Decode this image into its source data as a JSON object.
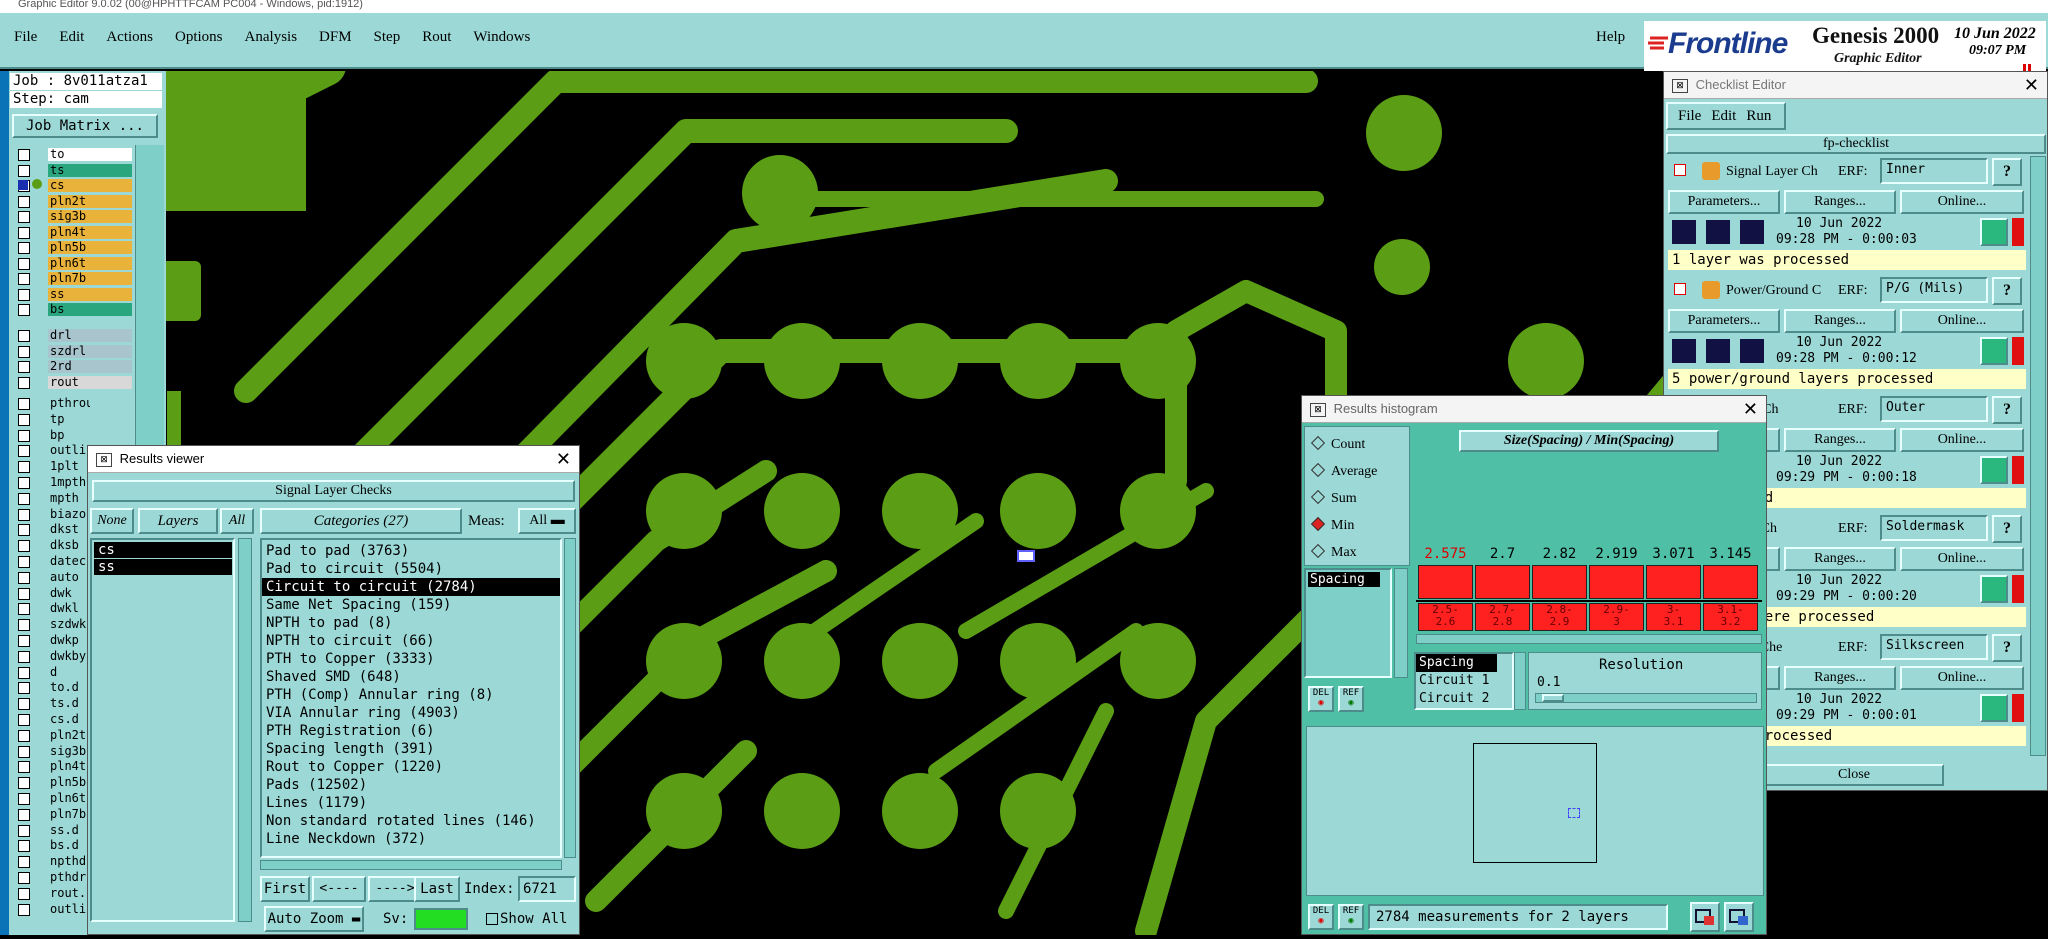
{
  "window_title": "Graphic Editor 9.0.02 (00@HPHTTFCAM PC004 - Windows, pid:1912)",
  "menu": [
    "File",
    "Edit",
    "Actions",
    "Options",
    "Analysis",
    "DFM",
    "Step",
    "Rout",
    "Windows"
  ],
  "help": "Help",
  "brand": {
    "logo": "Frontline",
    "product": "Genesis 2000",
    "subtitle": "Graphic Editor",
    "date": "10 Jun 2022",
    "time": "09:07 PM"
  },
  "job": {
    "job_label": "Job : 8v011atza1",
    "step_label": "Step: cam",
    "matrix_button": "Job Matrix ..."
  },
  "layers_top": [
    {
      "name": "to",
      "color": "#ffffff"
    },
    {
      "name": "ts",
      "color": "#2aa67e"
    },
    {
      "name": "cs",
      "color": "#e9b23a"
    },
    {
      "name": "pln2t",
      "color": "#e9b23a"
    },
    {
      "name": "sig3b",
      "color": "#e9b23a"
    },
    {
      "name": "pln4t",
      "color": "#e9b23a"
    },
    {
      "name": "pln5b",
      "color": "#e9b23a"
    },
    {
      "name": "pln6t",
      "color": "#e9b23a"
    },
    {
      "name": "pln7b",
      "color": "#e9b23a"
    },
    {
      "name": "ss",
      "color": "#e9b23a"
    },
    {
      "name": "bs",
      "color": "#2aa67e"
    }
  ],
  "layers_drill": [
    {
      "name": "drl",
      "color": "#a8c4cc"
    },
    {
      "name": "szdrl",
      "color": "#a8c4cc"
    },
    {
      "name": "2rd",
      "color": "#a8c4cc"
    },
    {
      "name": "rout",
      "color": "#d8d8d8"
    }
  ],
  "layers_misc": [
    "pthrou",
    "tp",
    "bp",
    "outli",
    "1plt",
    "1mpth",
    "mpth",
    "biazo",
    "dkst",
    "dksb",
    "datec",
    "auto",
    "dwk",
    "dwkl",
    "szdwk",
    "dwkp",
    "dwkby",
    "d",
    "to.d",
    "ts.d",
    "cs.d",
    "pln2t",
    "sig3b",
    "pln4t",
    "pln5b",
    "pln6t",
    "pln7b",
    "ss.d",
    "bs.d",
    "npthd",
    "pthdr",
    "rout.",
    "outli"
  ],
  "results_viewer": {
    "title": "Results viewer",
    "header": "Signal Layer Checks",
    "none": "None",
    "layers": "Layers",
    "all": "All",
    "categories_label": "Categories (27)",
    "meas_label": "Meas:",
    "meas_value": "All",
    "layer_items": [
      "cs",
      "ss"
    ],
    "categories": [
      "Pad to pad (3763)",
      "Pad to circuit (5504)",
      "Circuit to circuit (2784)",
      "Same Net Spacing (159)",
      "NPTH to pad (8)",
      "NPTH to circuit (66)",
      "PTH to Copper (3333)",
      "Shaved SMD (648)",
      "PTH (Comp) Annular ring (8)",
      "VIA Annular ring (4903)",
      "PTH Registration (6)",
      "Spacing length (391)",
      "Rout to Copper (1220)",
      "Pads (12502)",
      "Lines (1179)",
      "Non standard rotated lines (146)",
      "Line Neckdown (372)"
    ],
    "selected_category": 2,
    "first": "First",
    "prev": "<----",
    "next": "---->",
    "last": "Last",
    "index_label": "Index:",
    "index_value": "6721",
    "auto_zoom": "Auto Zoom",
    "sv_label": "Sv:",
    "show_all": "Show All"
  },
  "histogram": {
    "title": "Results histogram",
    "options": [
      "Count",
      "Average",
      "Sum",
      "Min",
      "Max"
    ],
    "selected_option": "Min",
    "left_item": "Spacing",
    "chart_title": "Size(Spacing) / Min(Spacing)",
    "bar_values": [
      "2.575",
      "2.7",
      "2.82",
      "2.919",
      "3.071",
      "3.145"
    ],
    "bin_labels": [
      [
        "2.5-",
        "2.6"
      ],
      [
        "2.7-",
        "2.8"
      ],
      [
        "2.8-",
        "2.9"
      ],
      [
        "2.9-",
        "3"
      ],
      [
        "3-",
        "3.1"
      ],
      [
        "3.1-",
        "3.2"
      ]
    ],
    "size_items": [
      "Spacing",
      "Circuit 1",
      "Circuit 2"
    ],
    "resolution_label": "Resolution",
    "resolution_value": "0.1",
    "del": "DEL",
    "ref": "REF",
    "status": "2784 measurements for 2 layers"
  },
  "checklist": {
    "title": "Checklist Editor",
    "menu": [
      "File",
      "Edit",
      "Run"
    ],
    "name": "fp-checklist",
    "erf_label": "ERF:",
    "params": "Parameters...",
    "ranges": "Ranges...",
    "online": "Online...",
    "close": "Close",
    "actions": [
      {
        "name": "Signal Layer Ch",
        "erf": "Inner",
        "date": "10 Jun 2022",
        "time": "09:28 PM - 0:00:03",
        "status": "1 layer was processed"
      },
      {
        "name": "Power/Ground C",
        "erf": "P/G (Mils)",
        "date": "10 Jun 2022",
        "time": "09:28 PM - 0:00:12",
        "status": "5 power/ground layers processed"
      },
      {
        "name": "Layer Ch",
        "erf": "Outer",
        "date": "10 Jun 2022",
        "time": "09:29 PM - 0:00:18",
        "status": "re processed"
      },
      {
        "name": "Mask Ch",
        "erf": "Soldermask",
        "date": "10 Jun 2022",
        "time": "09:29 PM - 0:00:20",
        "status": "sk layers were processed"
      },
      {
        "name": "creen Che",
        "erf": "Silkscreen",
        "date": "10 Jun 2022",
        "time": "09:29 PM - 0:00:01",
        "status": "en layers processed"
      }
    ]
  }
}
